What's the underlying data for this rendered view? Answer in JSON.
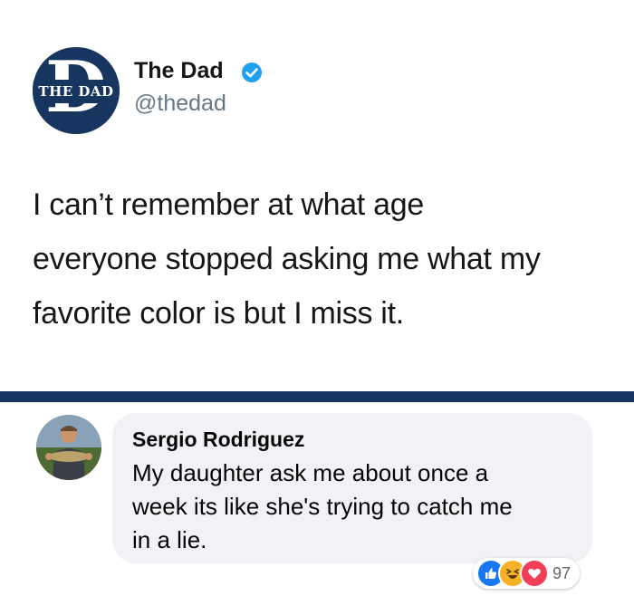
{
  "tweet": {
    "avatar_text": "THE DAD",
    "avatar_letter": "D",
    "name": "The Dad",
    "handle": "@thedad",
    "body_lines": [
      "I can’t remember at what age",
      "everyone stopped asking me what my",
      "favorite color is but I miss it."
    ]
  },
  "comment": {
    "author": "Sergio Rodriguez",
    "text_lines": [
      "My daughter ask me about once a",
      "week its like she's trying to catch me",
      "in a lie."
    ],
    "reaction_icons": [
      "like-icon",
      "haha-icon",
      "love-icon"
    ],
    "reaction_count": "97"
  },
  "colors": {
    "brand_navy": "#17365f",
    "verified_blue": "#1da1f2",
    "like_blue": "#1877f2",
    "haha_yellow": "#f7b125",
    "love_red": "#f33e58",
    "bubble_gray": "#f0f2f5",
    "handle_gray": "#657786"
  }
}
